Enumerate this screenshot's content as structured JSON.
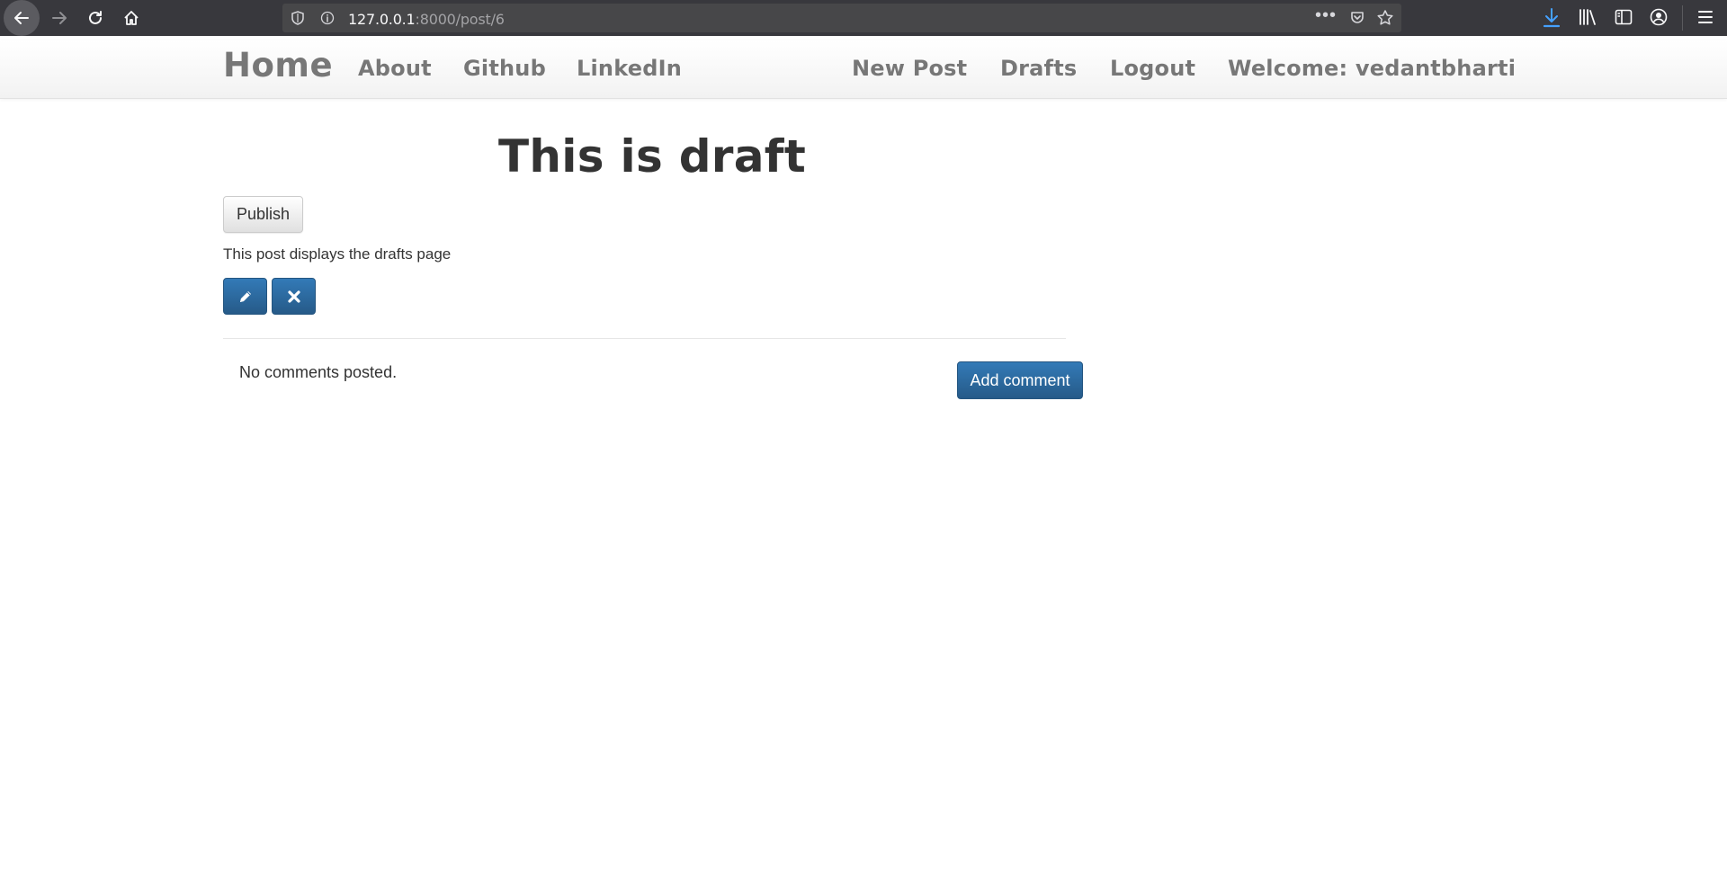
{
  "browser": {
    "url_host": "127.0.0.1",
    "url_path": ":8000/post/6",
    "page_actions_glyph": "•••"
  },
  "navbar": {
    "brand": "Home",
    "links_left": [
      "About",
      "Github",
      "LinkedIn"
    ],
    "links_right": [
      "New Post",
      "Drafts",
      "Logout"
    ],
    "welcome": "Welcome: vedantbharti"
  },
  "post": {
    "title": "This is draft",
    "publish_label": "Publish",
    "body": "This post displays the drafts page",
    "edit_icon": "pencil-icon",
    "remove_icon": "remove-icon"
  },
  "comments": {
    "empty_text": "No comments posted.",
    "add_label": "Add comment"
  },
  "colors": {
    "browser_chrome": "#38383d",
    "url_bar": "#474749",
    "nav_text": "#777777",
    "primary": "#337ab7",
    "text": "#333333"
  }
}
